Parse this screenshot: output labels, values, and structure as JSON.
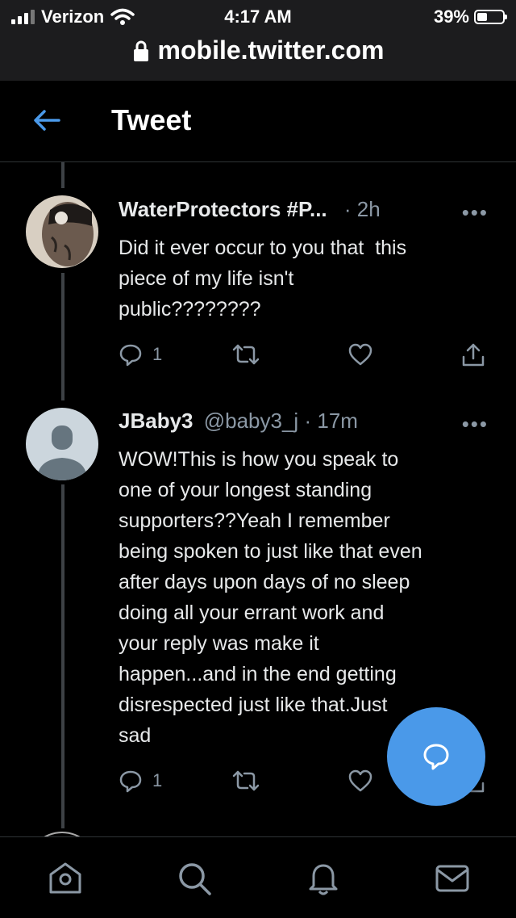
{
  "status_bar": {
    "carrier": "Verizon",
    "time": "4:17 AM",
    "battery": "39%",
    "battery_level": 0.39
  },
  "browser": {
    "url": "mobile.twitter.com"
  },
  "header": {
    "title": "Tweet"
  },
  "tweets": [
    {
      "name": "WaterProtectors #P...",
      "handle": "",
      "time": "2h",
      "text": "Did it ever occur to you that  this\npiece of my life isn't\npublic????????",
      "replies": "1",
      "more": "•••"
    },
    {
      "name": "JBaby3",
      "handle": "@baby3_j",
      "time": "17m",
      "text": "WOW!This is how you speak to\none of your longest standing\nsupporters??Yeah I remember\nbeing spoken to just like that even\nafter days upon days of no sleep\ndoing all your errant work and\nyour reply was make it\nhappen...and in the end getting\ndisrespected just like that.Just\nsad",
      "replies": "1",
      "more": "•••"
    }
  ],
  "colors": {
    "accent": "#4a99e9",
    "muted": "#8b98a5",
    "background": "#000000"
  },
  "icons": [
    "back-arrow-icon",
    "lock-icon",
    "reply-icon",
    "retweet-icon",
    "like-icon",
    "share-icon",
    "compose-reply-icon",
    "home-icon",
    "search-icon",
    "notifications-icon",
    "messages-icon"
  ]
}
